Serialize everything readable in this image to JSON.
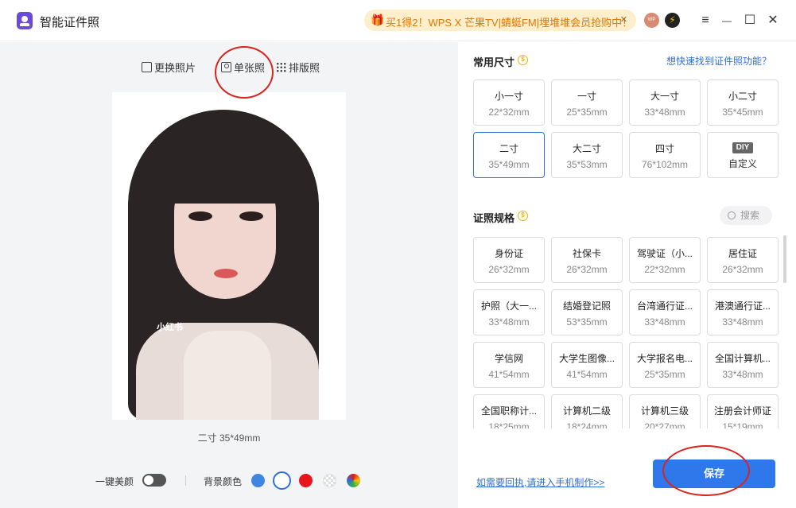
{
  "app": {
    "title": "智能证件照"
  },
  "promo": {
    "text": "买1得2！WPS X 芒果TV|蜻蜓FM|埋堆堆会员抢购中！",
    "close": "×"
  },
  "avatar": {
    "text": "WP"
  },
  "window": {
    "menu": "≡",
    "minimize": "—",
    "maximize": "☐",
    "close": "✕"
  },
  "left": {
    "tabs": [
      {
        "label": "更换照片"
      },
      {
        "label": "单张照"
      },
      {
        "label": "排版照"
      }
    ],
    "photo_watermark": "小红书",
    "caption": "二寸 35*49mm",
    "beauty_label": "一键美颜",
    "beauty_on": false,
    "bg_label": "背景颜色",
    "bg_colors": [
      "#3f86e0",
      "#ffffff",
      "#e8141c",
      "transparent",
      "rainbow"
    ],
    "bg_selected": "#ffffff"
  },
  "common_sizes": {
    "title": "常用尺寸",
    "coin": "$",
    "help_link": "想快速找到证件照功能？",
    "items": [
      {
        "name": "小一寸",
        "dim": "22*32mm"
      },
      {
        "name": "一寸",
        "dim": "25*35mm"
      },
      {
        "name": "大一寸",
        "dim": "33*48mm"
      },
      {
        "name": "小二寸",
        "dim": "35*45mm"
      },
      {
        "name": "二寸",
        "dim": "35*49mm",
        "selected": true
      },
      {
        "name": "大二寸",
        "dim": "35*53mm"
      },
      {
        "name": "四寸",
        "dim": "76*102mm"
      },
      {
        "name": "DIY",
        "dim": "自定义"
      }
    ]
  },
  "spec": {
    "title": "证照规格",
    "coin": "$",
    "search_placeholder": "搜索",
    "items": [
      {
        "name": "身份证",
        "dim": "26*32mm"
      },
      {
        "name": "社保卡",
        "dim": "26*32mm"
      },
      {
        "name": "驾驶证（小...",
        "dim": "22*32mm"
      },
      {
        "name": "居住证",
        "dim": "26*32mm"
      },
      {
        "name": "护照（大一...",
        "dim": "33*48mm"
      },
      {
        "name": "结婚登记照",
        "dim": "53*35mm"
      },
      {
        "name": "台湾通行证...",
        "dim": "33*48mm"
      },
      {
        "name": "港澳通行证...",
        "dim": "33*48mm"
      },
      {
        "name": "学信网",
        "dim": "41*54mm"
      },
      {
        "name": "大学生图像...",
        "dim": "41*54mm"
      },
      {
        "name": "大学报名电...",
        "dim": "25*35mm"
      },
      {
        "name": "全国计算机...",
        "dim": "33*48mm"
      },
      {
        "name": "全国职称计...",
        "dim": "18*25mm"
      },
      {
        "name": "计算机二级",
        "dim": "18*24mm"
      },
      {
        "name": "计算机三级",
        "dim": "20*27mm"
      },
      {
        "name": "注册会计师证",
        "dim": "15*19mm"
      }
    ]
  },
  "footer": {
    "phone_link": "如需要回执,请进入手机制作>>",
    "save": "保存"
  }
}
